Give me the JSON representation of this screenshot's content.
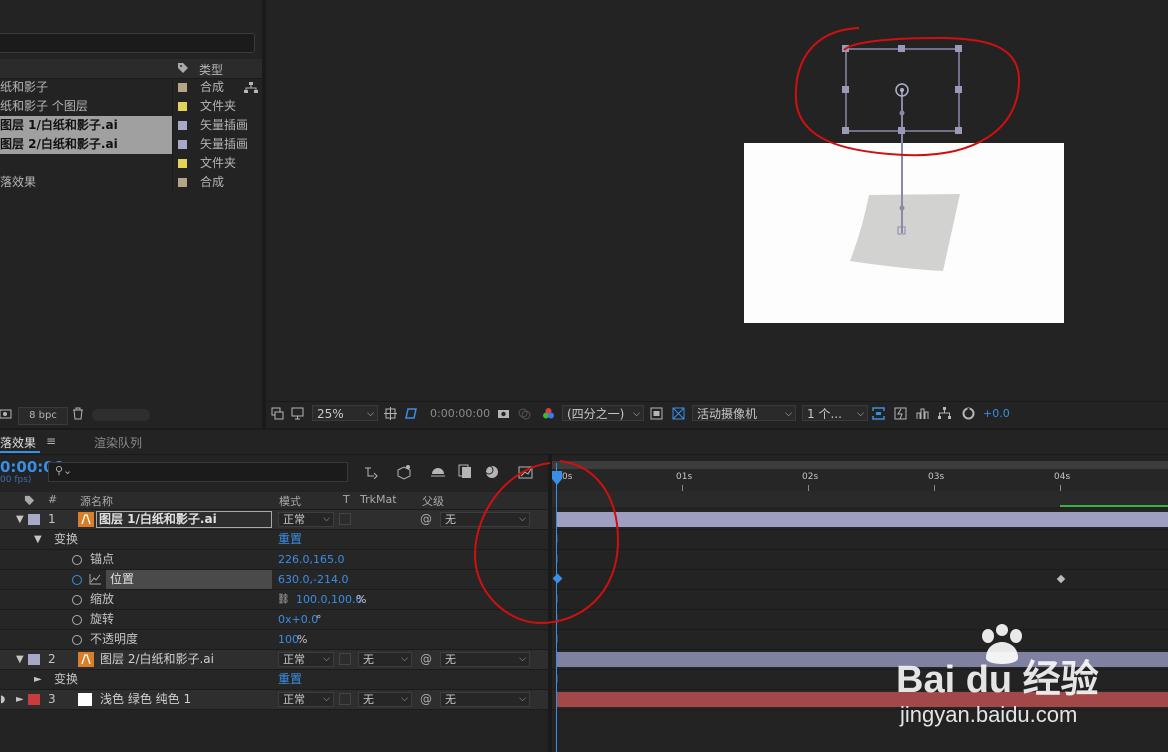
{
  "project": {
    "header": {
      "type_label": "类型"
    },
    "items": [
      {
        "name": "纸和影子",
        "type": "合成",
        "swatch": "#b4a48a",
        "selected": false
      },
      {
        "name": "纸和影子 个图层",
        "type": "文件夹",
        "swatch": "#e3d35a",
        "selected": false
      },
      {
        "name": "图层 1/白纸和影子.ai",
        "type": "矢量插画",
        "swatch": "#a8a8c8",
        "selected": true
      },
      {
        "name": "图层 2/白纸和影子.ai",
        "type": "矢量插画",
        "swatch": "#a8a8c8",
        "selected": true
      },
      {
        "name": "",
        "type": "文件夹",
        "swatch": "#e3d35a",
        "selected": false
      },
      {
        "name": "落效果",
        "type": "合成",
        "swatch": "#b4a48a",
        "selected": false
      }
    ],
    "bpc": "8 bpc"
  },
  "viewer_bar": {
    "zoom": "25%",
    "timecode": "0:00:00:00",
    "resolution": "(四分之一)",
    "camera": "活动摄像机",
    "views": "1 个...",
    "exposure": "+0.0"
  },
  "timeline": {
    "tabs": {
      "comp": "落效果",
      "menu_icon": "≡",
      "render_queue": "渲染队列"
    },
    "current_time": "0:00:00",
    "fps": "00 fps)",
    "columns": {
      "hash": "#",
      "source_name": "源名称",
      "mode": "模式",
      "t": "T",
      "trkmat": "TrkMat",
      "parent": "父级"
    },
    "ruler": [
      "0s",
      "01s",
      "02s",
      "03s",
      "04s"
    ],
    "layers": {
      "l1": {
        "num": "1",
        "name": "图层 1/白纸和影子.ai",
        "mode": "正常",
        "parent": "无",
        "label_color": "#a8a8c8"
      },
      "transform1": {
        "label": "变换",
        "reset": "重置"
      },
      "anchor": {
        "label": "锚点",
        "value": "226.0,165.0"
      },
      "position": {
        "label": "位置",
        "value": "630.0,-214.0"
      },
      "scale": {
        "label": "缩放",
        "value": "100.0,100.0",
        "unit": "%"
      },
      "rotation": {
        "label": "旋转",
        "value": "0x+0.0",
        "unit": "°"
      },
      "opacity": {
        "label": "不透明度",
        "value": "100",
        "unit": "%"
      },
      "l2": {
        "num": "2",
        "name": "图层 2/白纸和影子.ai",
        "mode": "正常",
        "trkmat": "无",
        "parent": "无",
        "label_color": "#a8a8c8"
      },
      "transform2": {
        "label": "变换",
        "reset": "重置"
      },
      "l3": {
        "num": "3",
        "name": "浅色 绿色 纯色 1",
        "mode": "正常",
        "trkmat": "无",
        "parent": "无",
        "label_color": "#c83c3c"
      }
    }
  },
  "watermark": {
    "brand": "Bai du 经验",
    "url": "jingyan.baidu.com"
  },
  "colors": {
    "accent": "#3a8ee6",
    "annotation": "#d01010"
  }
}
